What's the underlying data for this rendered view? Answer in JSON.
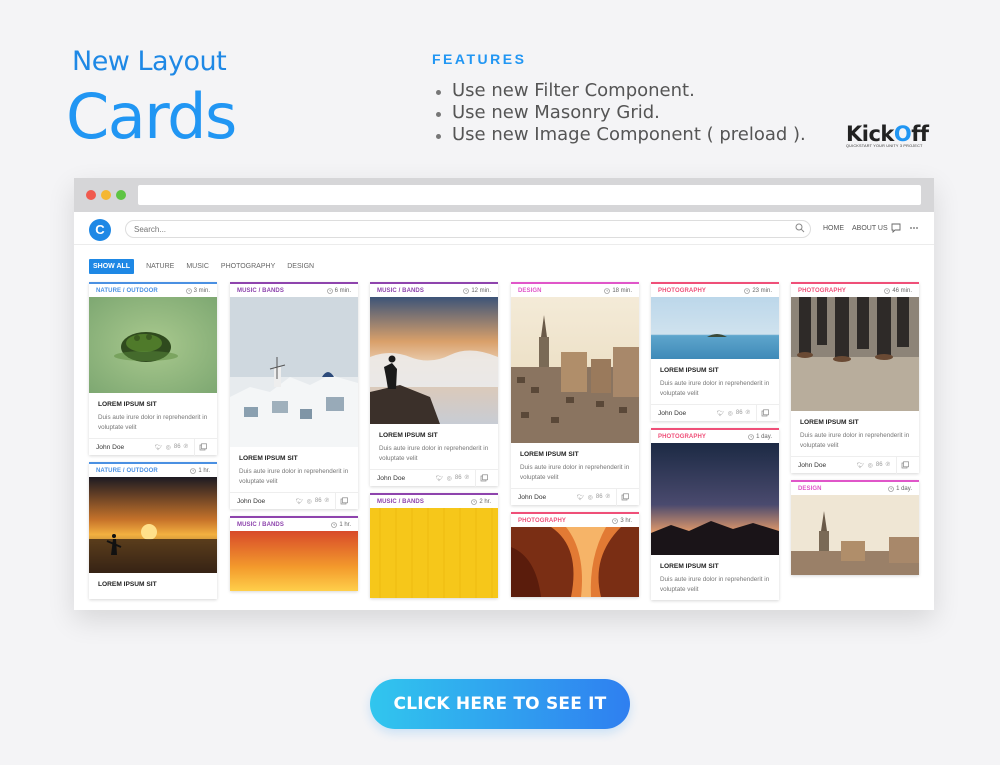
{
  "header": {
    "subtitle": "New Layout",
    "title": "Cards"
  },
  "features": {
    "heading": "FEATURES",
    "items": [
      "Use new Filter Component.",
      "Use new Masonry Grid.",
      "Use new Image Component ( preload )."
    ]
  },
  "brand": {
    "name_part1": "Kick",
    "name_o": "O",
    "name_part2": "ff",
    "tagline": "QUICKSTART YOUR UNITY 3 PROJECT"
  },
  "app": {
    "logo_letter": "C",
    "search_placeholder": "Search...",
    "nav": [
      "HOME",
      "ABOUT US"
    ],
    "filters": [
      "SHOW ALL",
      "NATURE",
      "MUSIC",
      "PHOTOGRAPHY",
      "DESIGN"
    ],
    "active_filter": "SHOW ALL"
  },
  "cards": {
    "c1": {
      "category": "NATURE / OUTDOOR",
      "time": "3 min.",
      "title": "LOREM IPSUM SIT",
      "text": "Duis aute irure dolor in reprehenderit in voluptate velit",
      "author": "John Doe",
      "likes": "86"
    },
    "c2": {
      "category": "NATURE / OUTDOOR",
      "time": "1 hr.",
      "title": "LOREM IPSUM SIT"
    },
    "c3": {
      "category": "MUSIC / BANDS",
      "time": "6 min.",
      "title": "LOREM IPSUM SIT",
      "text": "Duis aute irure dolor in reprehenderit in voluptate velit",
      "author": "John Doe",
      "likes": "86"
    },
    "c4": {
      "category": "MUSIC / BANDS",
      "time": "1 hr."
    },
    "c5": {
      "category": "MUSIC / BANDS",
      "time": "12 min.",
      "title": "LOREM IPSUM SIT",
      "text": "Duis aute irure dolor in reprehenderit in voluptate velit",
      "author": "John Doe",
      "likes": "86"
    },
    "c6": {
      "category": "MUSIC / BANDS",
      "time": "2 hr."
    },
    "c7": {
      "category": "DESIGN",
      "time": "18 min.",
      "title": "LOREM IPSUM SIT",
      "text": "Duis aute irure dolor in reprehenderit in voluptate velit",
      "author": "John Doe",
      "likes": "86"
    },
    "c8": {
      "category": "PHOTOGRAPHY",
      "time": "3 hr."
    },
    "c9": {
      "category": "PHOTOGRAPHY",
      "time": "23 min.",
      "title": "LOREM IPSUM SIT",
      "text": "Duis aute irure dolor in reprehenderit in voluptate velit",
      "author": "John Doe",
      "likes": "86"
    },
    "c10": {
      "category": "PHOTOGRAPHY",
      "time": "1 day.",
      "title": "LOREM IPSUM SIT",
      "text": "Duis aute irure dolor in reprehenderit in voluptate velit"
    },
    "c11": {
      "category": "PHOTOGRAPHY",
      "time": "46 min.",
      "title": "LOREM IPSUM SIT",
      "text": "Duis aute irure dolor in reprehenderit in voluptate velit",
      "author": "John Doe",
      "likes": "86"
    },
    "c12": {
      "category": "DESIGN",
      "time": "1 day."
    }
  },
  "colors": {
    "nature": "#4a90e2",
    "music": "#8e44ad",
    "design": "#e056c9",
    "photography": "#ef4f78",
    "accent": "#1e88e5"
  },
  "cta": {
    "label": "CLICK HERE TO SEE IT"
  }
}
